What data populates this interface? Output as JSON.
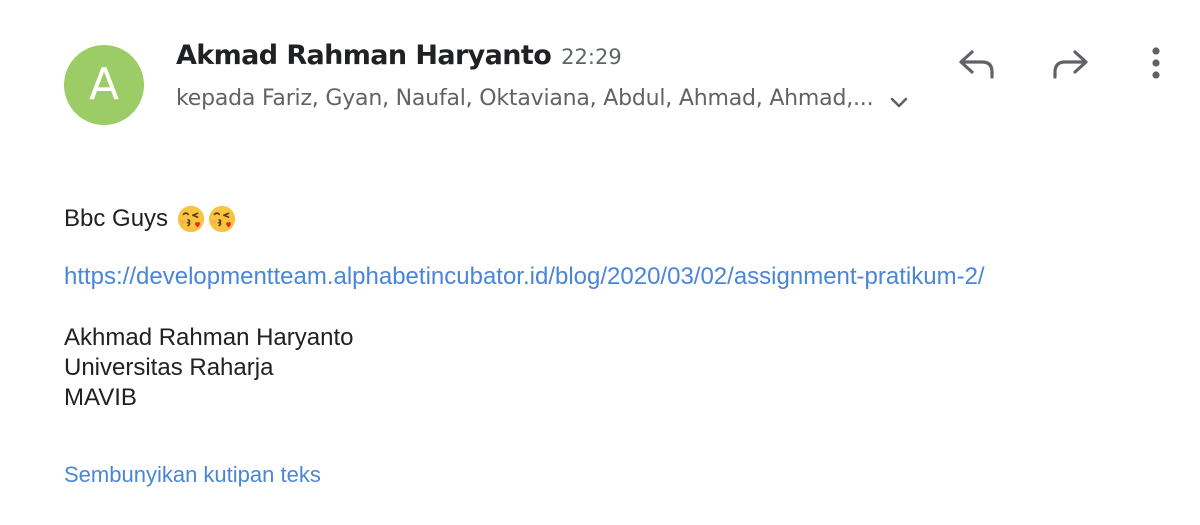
{
  "email": {
    "avatar_letter": "A",
    "avatar_color": "#9ccc65",
    "sender_name": "Akmad Rahman Haryanto",
    "time": "22:29",
    "recipients": "kepada Fariz, Gyan, Naufal, Oktaviana, Abdul, Ahmad, Ahmad,...",
    "actions": {
      "reply_icon": "reply-icon",
      "forward_icon": "forward-icon",
      "more_icon": "more-vert-icon",
      "expand_icon": "chevron-down-icon"
    },
    "body": {
      "greeting": "Bbc Guys",
      "emoji_icon": "kissing-heart-emoji",
      "link": "https://developmentteam.alphabetincubator.id/blog/2020/03/02/assignment-pratikum-2/",
      "signature": [
        "Akhmad Rahman Haryanto",
        "Universitas Raharja",
        "MAVIB"
      ]
    },
    "hide_quoted_text": "Sembunyikan kutipan teks",
    "link_color": "#4a86d8"
  }
}
